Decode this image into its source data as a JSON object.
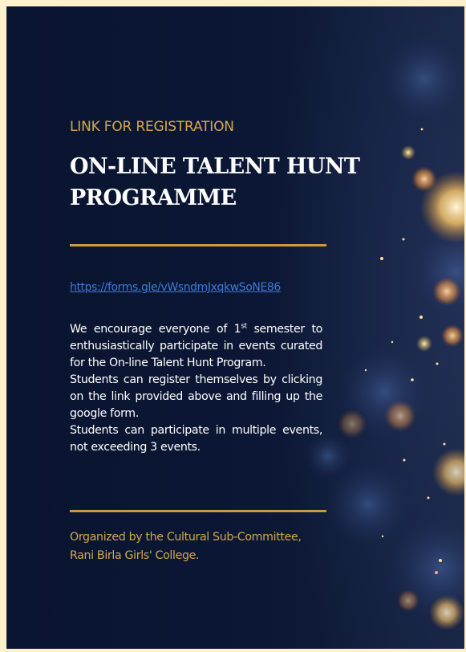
{
  "kicker": "LINK FOR REGISTRATION",
  "title": "ON-LINE TALENT HUNT PROGRAMME",
  "registration_link": "https://forms.gle/vWsndmJxqkwSoNE86",
  "body": {
    "para1_pre": "We encourage everyone of 1",
    "para1_sup": "st",
    "para1_post": " semester to enthusiastically participate in events curated for the  On-line Talent Hunt Program.",
    "para2": "Students can register themselves by clicking on the link provided above and filling up the google form.",
    "para3": "Students can participate in multiple events, not exceeding 3 events."
  },
  "organizer": "Organized by the Cultural Sub-Committee, Rani Birla Girls' College.",
  "colors": {
    "background": "#0a1631",
    "accent_gold": "#d4a94d",
    "link_blue": "#3c7bd4",
    "page_border": "#fdf1cc"
  }
}
